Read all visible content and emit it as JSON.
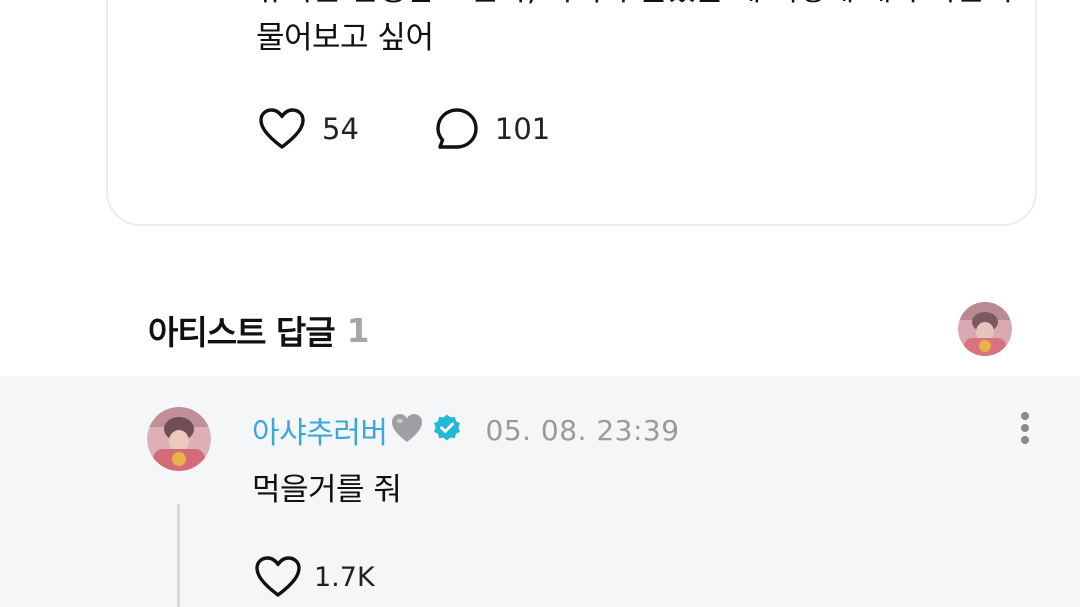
{
  "post": {
    "text": "유치원 선생님 도훈아, 아이가 울었을 때 어떻게 해야 하는지\n물어보고 싶어",
    "like_count": "54",
    "comment_count": "101"
  },
  "artist_replies": {
    "title": "아티스트 답글",
    "count": "1"
  },
  "reply": {
    "author": "아샤추러버",
    "timestamp": "05. 08. 23:39",
    "text": "먹을거를 줘",
    "like_count": "1.7K"
  },
  "colors": {
    "author_accent": "#3aa7df",
    "verified_badge": "#22b8d6",
    "reply_background": "#f5f6f8"
  },
  "icons": {
    "like": "heart-outline-icon",
    "comment": "speech-bubble-icon",
    "verified": "verified-badge-icon",
    "more": "more-vertical-icon",
    "author_emoji": "grey-heart-icon"
  }
}
